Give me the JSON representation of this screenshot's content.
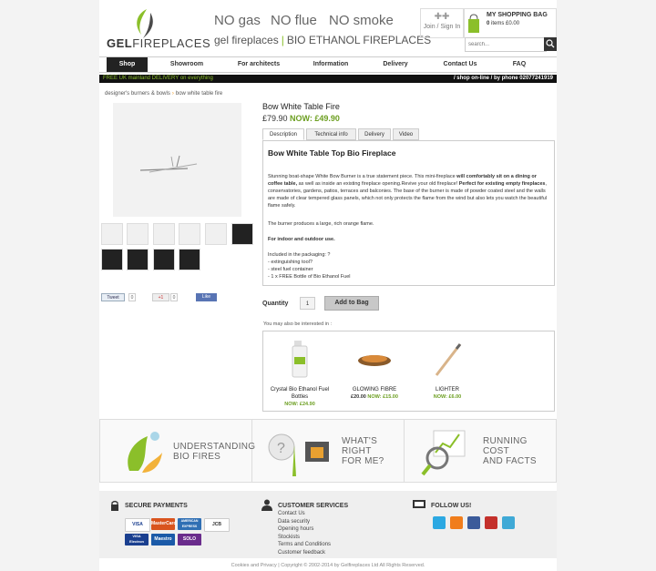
{
  "header": {
    "logo_text_1": "GEL",
    "logo_text_2": "FIREPLACES",
    "slogans": [
      "NO gas",
      "NO flue",
      "NO smoke"
    ],
    "brand_line_1": "gel fireplaces",
    "brand_line_2": "BIO ETHANOL FIREPLACES",
    "join_label": "Join / Sign In",
    "bag_title": "MY SHOPPING BAG",
    "bag_count": "0",
    "bag_items_text": "items £0.00",
    "search_placeholder": "search..."
  },
  "nav": {
    "items": [
      {
        "label": "Shop",
        "active": true
      },
      {
        "label": "Showroom"
      },
      {
        "label": "For architects"
      },
      {
        "label": "Information"
      },
      {
        "label": "Delivery"
      },
      {
        "label": "Contact Us"
      },
      {
        "label": "FAQ"
      }
    ]
  },
  "promo": {
    "left": "FREE UK mainland DELIVERY on everything",
    "right": "/ shop on-line / by phone 02077241919"
  },
  "breadcrumb": {
    "parent": "designer's burners & bowls",
    "current": "bow white table fire"
  },
  "product": {
    "title": "Bow White Table Fire",
    "price_was": "£79.90",
    "price_now": "NOW: £49.90",
    "tabs": [
      "Description",
      "Technical info",
      "Delivery",
      "Video"
    ],
    "desc_heading": "Bow White Table Top Bio Fireplace",
    "desc_p1_a": "Stunning boat-shape White Bow Burner is a true statement piece. This mini-fireplace ",
    "desc_p1_b": "will comfortably sit on a dining or coffee table,",
    "desc_p1_c": " as well as inside an existing fireplace opening.Revive your old fireplace! ",
    "desc_p1_d": "Perfect for existing empty fireplaces",
    "desc_p1_e": ", conservatories, gardens, patios, terraces and balconies. The base of the burner is made of powder coated steel and the walls are made of clear tempered glass panels, which not only protects the flame from the wind but also lets you watch the beautiful flame safely.",
    "desc_p2": "The burner produces a large, rich orange flame.",
    "desc_p3": "For indoor and outdoor use.",
    "desc_p4_title": "Included in the packaging: ?",
    "desc_p4_items": [
      "- extinguishing tool?",
      "- steel fuel container",
      "- 1 x FREE Bottle of Bio Ethanol Fuel"
    ],
    "qty_label": "Quantity",
    "qty_value": "1",
    "add_to_bag": "Add to Bag"
  },
  "social": {
    "tweet": "Tweet",
    "tweet_count": "0",
    "gplus": "+1",
    "gplus_count": "0",
    "like": "Like"
  },
  "related": {
    "heading": "You may also be interested in :",
    "items": [
      {
        "name": "Crystal Bio Ethanol Fuel Bottles",
        "was": "",
        "now": "NOW: £24.90"
      },
      {
        "name": "GLOWING FIBRE",
        "was": "£20.00",
        "now": "NOW: £15.00"
      },
      {
        "name": "LIGHTER",
        "was": "",
        "now": "NOW: £6.00"
      }
    ]
  },
  "banners": [
    {
      "line1": "UNDERSTANDING",
      "line2": "BIO FIRES"
    },
    {
      "line1": "WHAT'S",
      "line2": "RIGHT",
      "line3": "FOR ME?"
    },
    {
      "line1": "RUNNING",
      "line2": "COST",
      "line3": "AND FACTS"
    }
  ],
  "footer": {
    "payments_title": "SECURE PAYMENTS",
    "cards": [
      "VISA",
      "MasterCard",
      "AMERICAN EXPRESS",
      "JCB",
      "VISA Electron",
      "Maestro",
      "SOLO"
    ],
    "customer_title": "CUSTOMER SERVICES",
    "customer_links": [
      "Contact Us",
      "Data security",
      "Opening hours",
      "Stockists",
      "Terms and Conditions",
      "Customer feedback"
    ],
    "follow_title": "FOLLOW US!",
    "social_icons": [
      "skype-icon",
      "blogger-icon",
      "facebook-icon",
      "youtube-icon",
      "twitter-icon"
    ],
    "copyright": "Cookies and Privacy | Copyright © 2002-2014 by Gelfireplaces Ltd All Rights Reserved."
  },
  "colors": {
    "accent_green": "#6b9e1f",
    "promo_green": "#8bbf2a",
    "nav_active": "#222222"
  }
}
